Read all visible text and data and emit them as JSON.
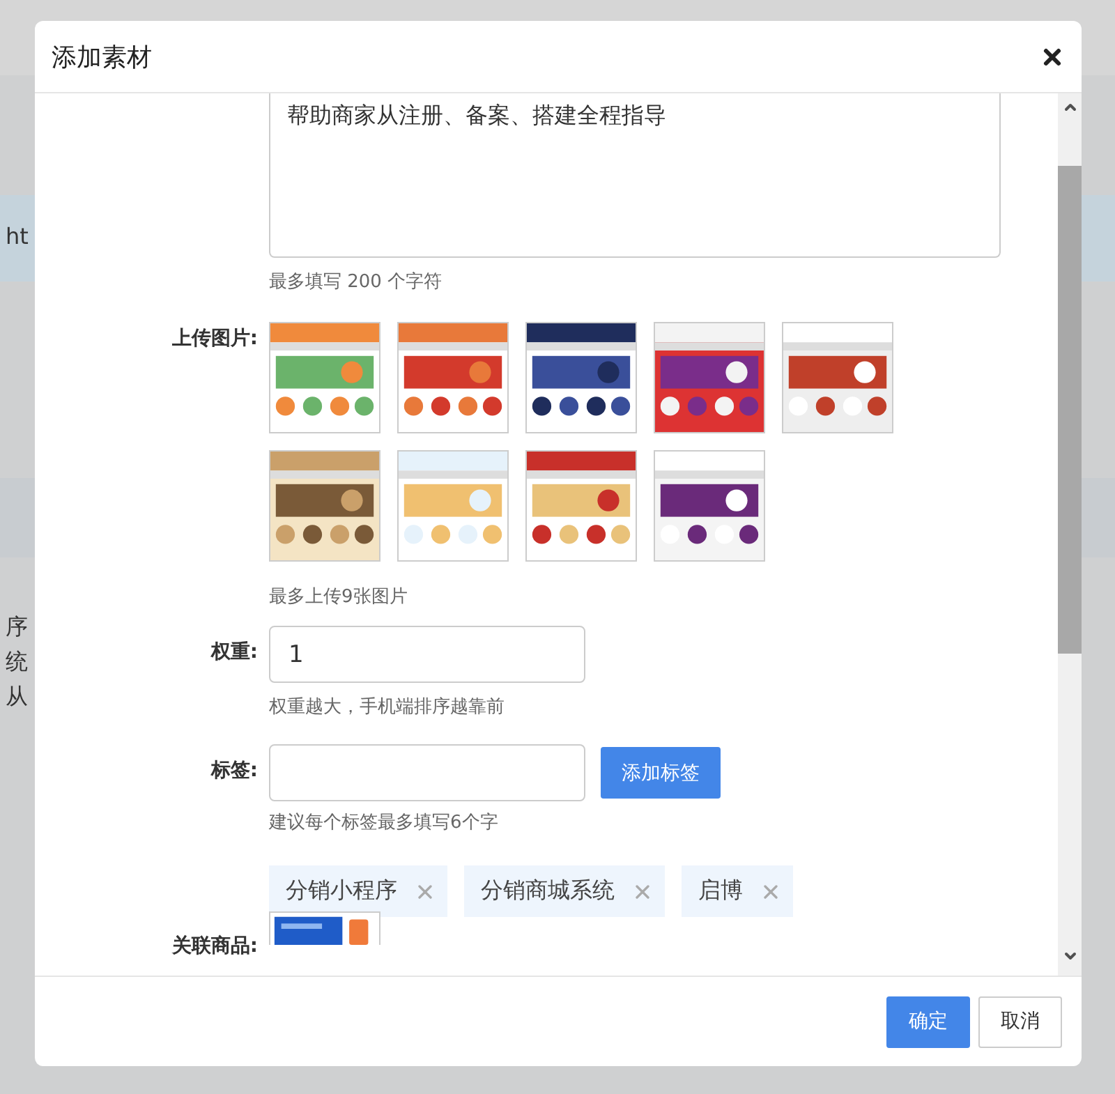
{
  "background": {
    "fragments": [
      "ht",
      "序",
      "统",
      "从"
    ]
  },
  "dialog": {
    "title": "添加素材",
    "description": {
      "value": "帮助商家从注册、备案、搭建全程指导",
      "hint": "最多填写 200 个字符"
    },
    "images": {
      "label": "上传图片:",
      "hint": "最多上传9张图片"
    },
    "weight": {
      "label": "权重:",
      "value": "1",
      "hint": "权重越大，手机端排序越靠前"
    },
    "tags": {
      "label": "标签:",
      "button": "添加标签",
      "hint": "建议每个标签最多填写6个字",
      "items": [
        "分销小程序",
        "分销商城系统",
        "启博"
      ]
    },
    "related": {
      "label": "关联商品:"
    },
    "buttons": [
      {
        "label": "确定",
        "kind": "primary"
      },
      {
        "label": "取消",
        "kind": "default"
      }
    ]
  }
}
